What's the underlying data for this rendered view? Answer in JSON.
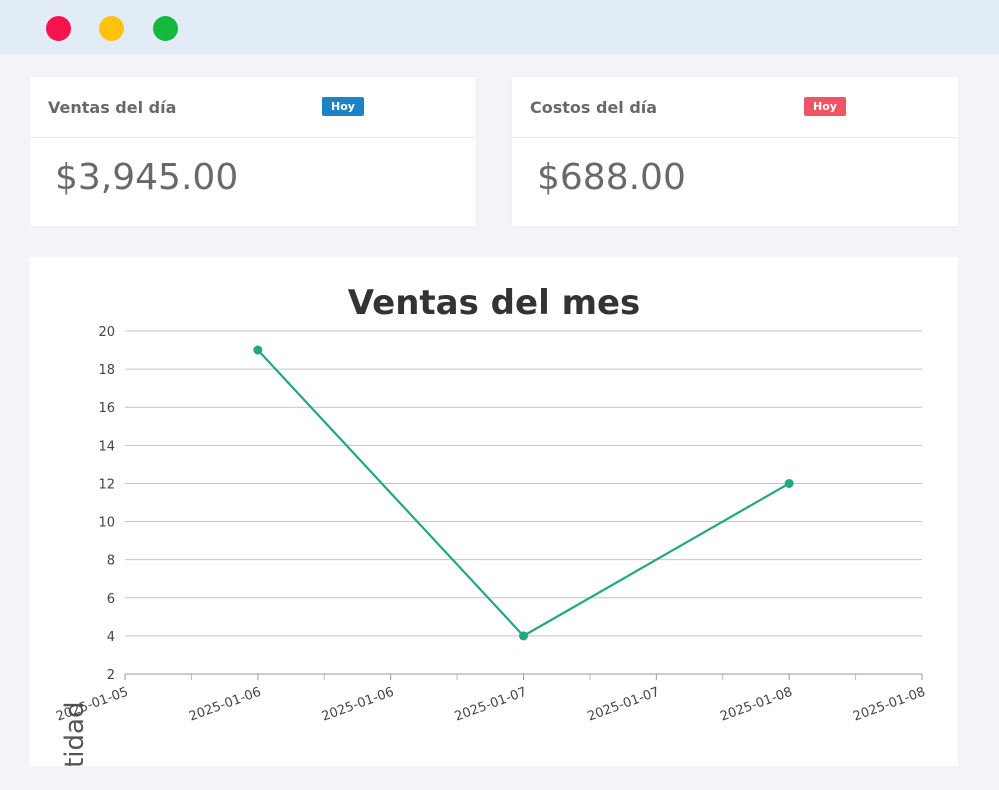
{
  "window": {
    "buttons": [
      "close",
      "minimize",
      "maximize"
    ],
    "colors": {
      "close": "#f5144f",
      "minimize": "#ffc20e",
      "maximize": "#14b93c"
    }
  },
  "cards": [
    {
      "title": "Ventas del día",
      "badge": "Hoy",
      "badge_color": "#1c84c6",
      "value": "$3,945.00"
    },
    {
      "title": "Costos del día",
      "badge": "Hoy",
      "badge_color": "#ed5565",
      "value": "$688.00"
    }
  ],
  "chart_data": {
    "type": "line",
    "title": "Ventas del mes",
    "xlabel": "",
    "ylabel": "Cantidad",
    "ylim": [
      2,
      20
    ],
    "yticks": [
      2,
      4,
      6,
      8,
      10,
      12,
      14,
      16,
      18,
      20
    ],
    "xticks": [
      "2025-01-05",
      "2025-01-06",
      "2025-01-06",
      "2025-01-07",
      "2025-01-07",
      "2025-01-08",
      "2025-01-08"
    ],
    "x": [
      "2025-01-06",
      "2025-01-07",
      "2025-01-08"
    ],
    "series": [
      {
        "values": [
          19,
          4,
          12
        ],
        "color": "#22a683"
      }
    ],
    "grid": true
  }
}
